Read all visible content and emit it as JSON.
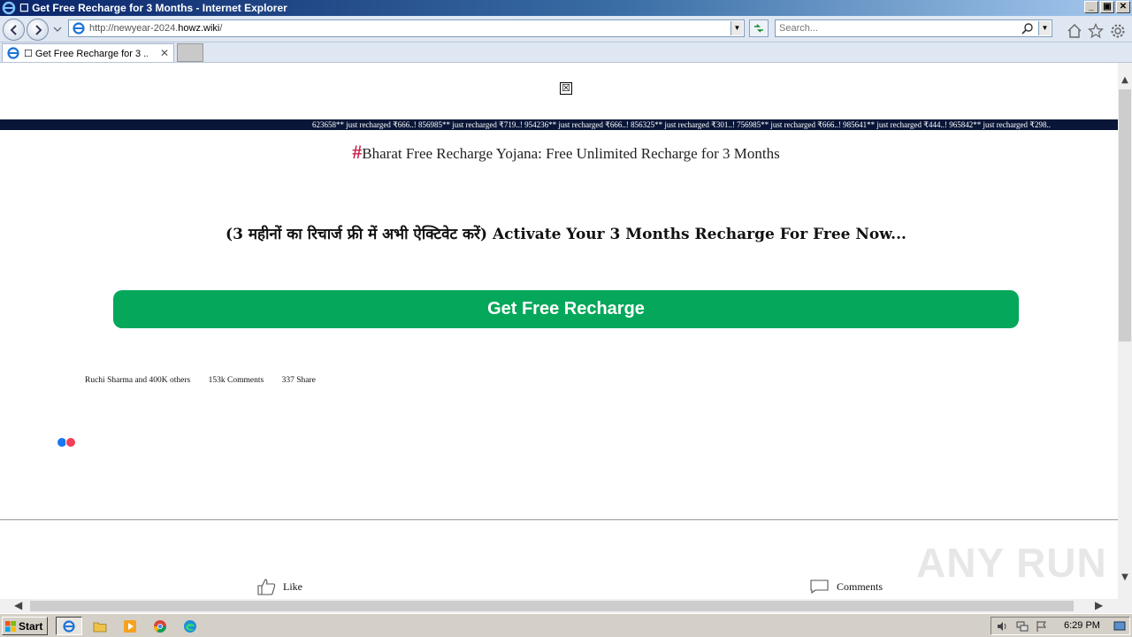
{
  "window": {
    "title": "☐ Get Free Recharge for 3 Months - Internet Explorer",
    "controls": {
      "minimize": "_",
      "restore": "▣",
      "close": "✕"
    }
  },
  "toolbar": {
    "address_prefix": "http://newyear-2024.",
    "address_domain": "howz.wiki",
    "address_suffix": "/",
    "search_placeholder": "Search..."
  },
  "tab": {
    "title": "☐ Get Free Recharge for 3 ...",
    "close": "✕"
  },
  "page": {
    "popup_close": "☒",
    "ticker": "623658** just recharged ₹666..! 856985** just recharged ₹719..! 954236** just recharged ₹666..! 856325** just recharged ₹301..! 756985** just recharged ₹666..! 985641** just recharged ₹444..! 965842** just recharged ₹298..",
    "headline_hash": "#",
    "headline": "Bharat Free Recharge Yojana: Free Unlimited Recharge for 3 Months",
    "subhead": "(3 महीनों का रिचार्ज फ्री में अभी ऐक्टिवेट करें) Activate Your 3 Months Recharge For Free Now...",
    "cta_label": "Get Free Recharge",
    "social": {
      "likes": "Ruchi Sharma and 400K others",
      "comments": "153k  Comments",
      "shares": "337  Share"
    },
    "like_label": "Like",
    "comments_label": "Comments",
    "watermark": "ANY RUN"
  },
  "taskbar": {
    "start_label": "Start",
    "clock": "6:29 PM"
  },
  "colors": {
    "cta_bg": "#05a85a",
    "ticker_bg": "#091637",
    "hash": "#c7254e"
  }
}
